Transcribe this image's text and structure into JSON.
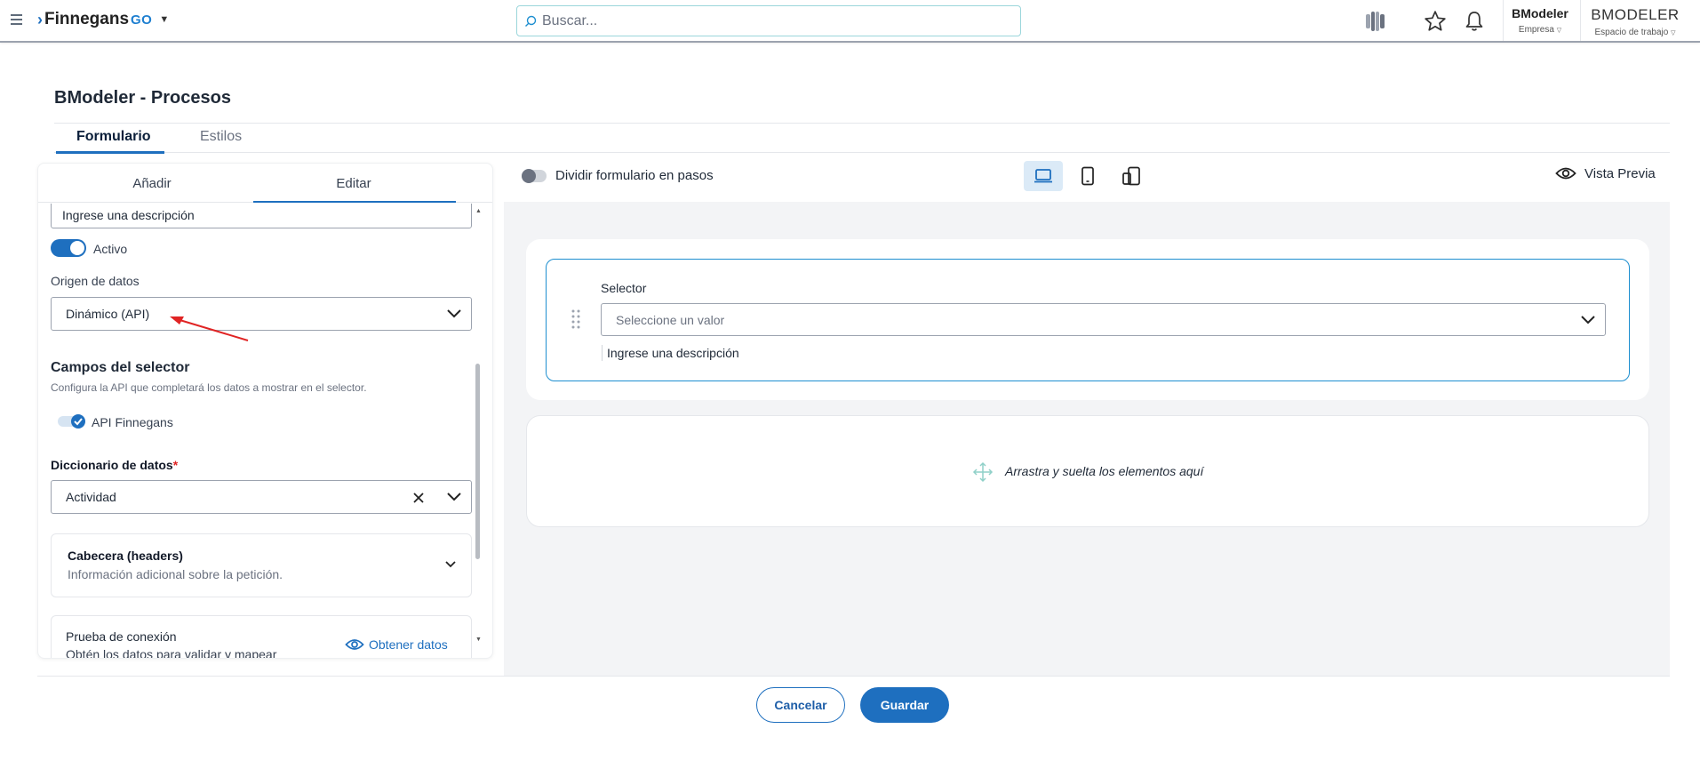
{
  "topbar": {
    "brand": "Finnegans",
    "brand_suffix": "GO",
    "search_placeholder": "Buscar...",
    "account": {
      "company_name": "BModeler",
      "company_label": "Empresa",
      "workspace_name": "BMODELER",
      "workspace_label": "Espacio de trabajo"
    }
  },
  "page": {
    "title": "BModeler - Procesos",
    "tabs": [
      {
        "label": "Formulario"
      },
      {
        "label": "Estilos"
      }
    ]
  },
  "left_panel": {
    "tabs": [
      {
        "label": "Añadir"
      },
      {
        "label": "Editar"
      }
    ],
    "description_value": "Ingrese una descripción",
    "active_label": "Activo",
    "origin_label": "Origen de datos",
    "origin_value": "Dinámico (API)",
    "section_title": "Campos del selector",
    "section_desc": "Configura la API que completará los datos a mostrar en el selector.",
    "api_label": "API Finnegans",
    "dictionary_label": "Diccionario de datos",
    "dictionary_required": "*",
    "dictionary_value": "Actividad",
    "headers_title": "Cabecera (headers)",
    "headers_desc": "Información adicional sobre la petición.",
    "connection_title": "Prueba de conexión",
    "connection_desc": "Obtén los datos para validar y mapear",
    "fetch_label": "Obtener datos"
  },
  "right_area": {
    "split_label": "Dividir formulario en pasos",
    "preview_label": "Vista Previa",
    "selector_label": "Selector",
    "selector_placeholder": "Seleccione un valor",
    "selector_description": "Ingrese una descripción",
    "dropzone_text": "Arrastra y suelta los elementos aquí"
  },
  "footer": {
    "cancel_label": "Cancelar",
    "save_label": "Guardar"
  },
  "colors": {
    "primary": "#1e6fbf",
    "annotation_arrow": "#e02424",
    "canvas_bg": "#f3f4f6"
  }
}
